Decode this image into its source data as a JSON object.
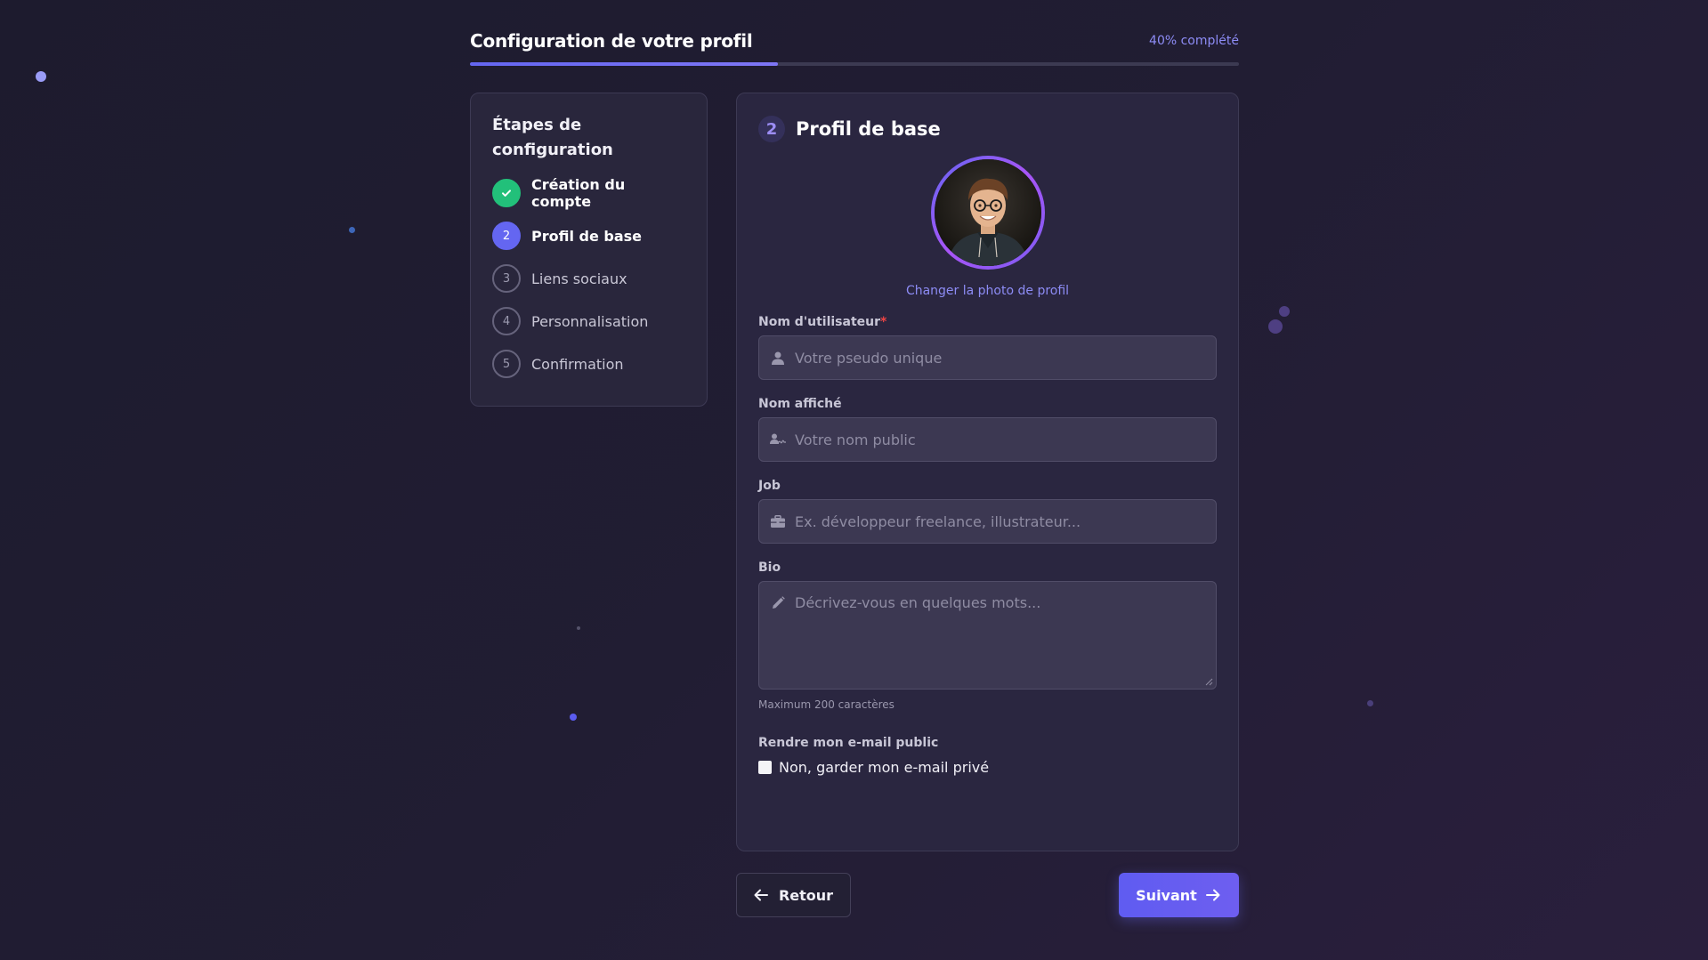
{
  "header": {
    "title": "Configuration de votre profil",
    "progress_label": "40% complété",
    "progress_value": 0.4
  },
  "steps": {
    "title": "Étapes de configuration",
    "items": [
      {
        "number": "",
        "label": "Création du compte",
        "state": "done"
      },
      {
        "number": "2",
        "label": "Profil de base",
        "state": "active"
      },
      {
        "number": "3",
        "label": "Liens sociaux",
        "state": "pending"
      },
      {
        "number": "4",
        "label": "Personnalisation",
        "state": "pending"
      },
      {
        "number": "5",
        "label": "Confirmation",
        "state": "pending"
      }
    ]
  },
  "form": {
    "step_number": "2",
    "title": "Profil de base",
    "change_photo": "Changer la photo de profil",
    "username": {
      "label": "Nom d'utilisateur",
      "required_mark": "*",
      "placeholder": "Votre pseudo unique",
      "value": "",
      "icon": "user-icon"
    },
    "display_name": {
      "label": "Nom affiché",
      "placeholder": "Votre nom public",
      "value": "",
      "icon": "signature-icon"
    },
    "job": {
      "label": "Job",
      "placeholder": "Ex. développeur freelance, illustrateur...",
      "value": "",
      "icon": "briefcase-icon"
    },
    "bio": {
      "label": "Bio",
      "placeholder": "Décrivez-vous en quelques mots...",
      "value": "",
      "icon": "pencil-icon",
      "hint": "Maximum 200 caractères"
    },
    "email_public": {
      "label": "Rendre mon e-mail public",
      "checkbox_label": "Non, garder mon e-mail privé",
      "checked": false
    }
  },
  "nav": {
    "back_label": "Retour",
    "next_label": "Suivant"
  },
  "colors": {
    "accent": "#6466f1",
    "success": "#22c07a",
    "link": "#8d8cf5",
    "background": "#1d1b2e"
  }
}
